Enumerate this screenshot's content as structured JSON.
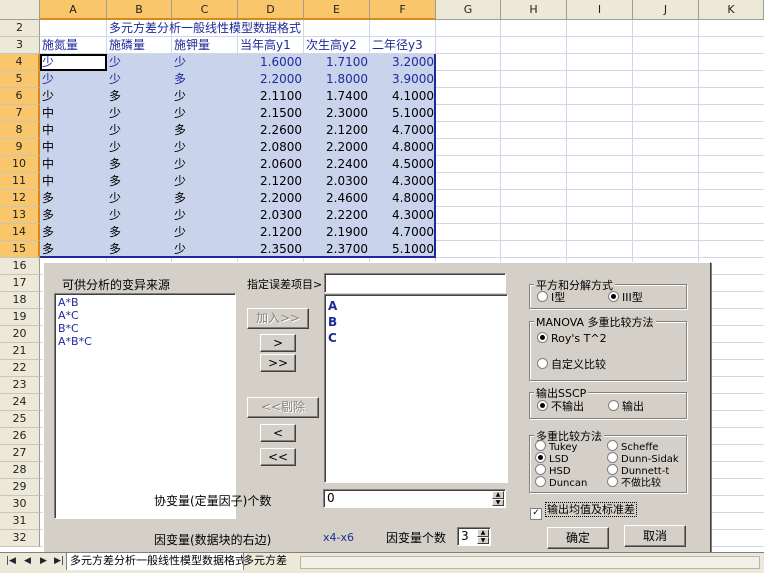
{
  "columns": [
    "A",
    "B",
    "C",
    "D",
    "E",
    "F",
    "G",
    "H",
    "I",
    "J",
    "K"
  ],
  "rows": [
    "2",
    "3",
    "4",
    "5",
    "6",
    "7",
    "8",
    "9",
    "10",
    "11",
    "12",
    "13",
    "14",
    "15",
    "16",
    "17",
    "18",
    "19",
    "20",
    "21",
    "22",
    "23",
    "24",
    "25",
    "26",
    "27",
    "28",
    "29",
    "30",
    "31",
    "32"
  ],
  "sheet_title": "多元方差分析一般线性模型数据格式",
  "headers": [
    "施氮量",
    "施磷量",
    "施钾量",
    "当年高y1",
    "次生高y2",
    "二年径y3"
  ],
  "data_rows": [
    [
      "少",
      "少",
      "少",
      "1.6000",
      "1.7100",
      "3.2000"
    ],
    [
      "少",
      "少",
      "多",
      "2.2000",
      "1.8000",
      "3.9000"
    ],
    [
      "少",
      "多",
      "少",
      "2.1100",
      "1.7400",
      "4.1000"
    ],
    [
      "中",
      "少",
      "少",
      "2.1500",
      "2.3000",
      "5.1000"
    ],
    [
      "中",
      "少",
      "多",
      "2.2600",
      "2.1200",
      "4.7000"
    ],
    [
      "中",
      "少",
      "少",
      "2.0800",
      "2.2000",
      "4.8000"
    ],
    [
      "中",
      "多",
      "少",
      "2.0600",
      "2.2400",
      "4.5000"
    ],
    [
      "中",
      "多",
      "少",
      "2.1200",
      "2.0300",
      "4.3000"
    ],
    [
      "多",
      "少",
      "多",
      "2.2000",
      "2.4600",
      "4.8000"
    ],
    [
      "多",
      "少",
      "少",
      "2.0300",
      "2.2200",
      "4.3000"
    ],
    [
      "多",
      "多",
      "少",
      "2.1200",
      "2.1900",
      "4.7000"
    ],
    [
      "多",
      "多",
      "少",
      "2.3500",
      "2.3700",
      "5.1000"
    ]
  ],
  "dialog": {
    "available_sources_label": "可供分析的变异来源",
    "available_sources": [
      "A*B",
      "A*C",
      "B*C",
      "A*B*C"
    ],
    "error_term_label": "指定误差项目>",
    "error_term_value": "",
    "selected_sources": [
      "A",
      "B",
      "C"
    ],
    "add_button": "加入>>",
    "move_right": ">",
    "move_all_right": ">>",
    "remove_button": "<<剔除",
    "move_left": "<",
    "move_all_left": "<<",
    "covariate_label": "协变量(定量因子)个数",
    "covariate_value": "0",
    "dependent_label": "因变量(数据块的右边)",
    "dependent_range": "x4-x6",
    "dependent_count_label": "因变量个数",
    "dependent_count_value": "3",
    "ss_group_title": "平方和分解方式",
    "ss_options": [
      "I型",
      "III型"
    ],
    "ss_selected": "III型",
    "manova_group_title": "MANOVA 多重比较方法",
    "manova_options": [
      "Roy's T^2",
      "自定义比较"
    ],
    "manova_selected": "Roy's T^2",
    "sscp_group_title": "输出SSCP",
    "sscp_options": [
      "不输出",
      "输出"
    ],
    "sscp_selected": "不输出",
    "mc_group_title": "多重比较方法",
    "mc_options_left": [
      "Tukey",
      "LSD",
      "HSD",
      "Duncan"
    ],
    "mc_options_right": [
      "Scheffe",
      "Dunn-Sidak",
      "Dunnett-t",
      "不做比较"
    ],
    "mc_selected": "LSD",
    "output_means_label": "输出均值及标准差",
    "output_means_checked": true,
    "ok_button": "确定",
    "cancel_button": "取消"
  },
  "tabs": {
    "sheet1": "多元方差分析一般线性模型数据格式",
    "sheet2": "多元方差"
  }
}
